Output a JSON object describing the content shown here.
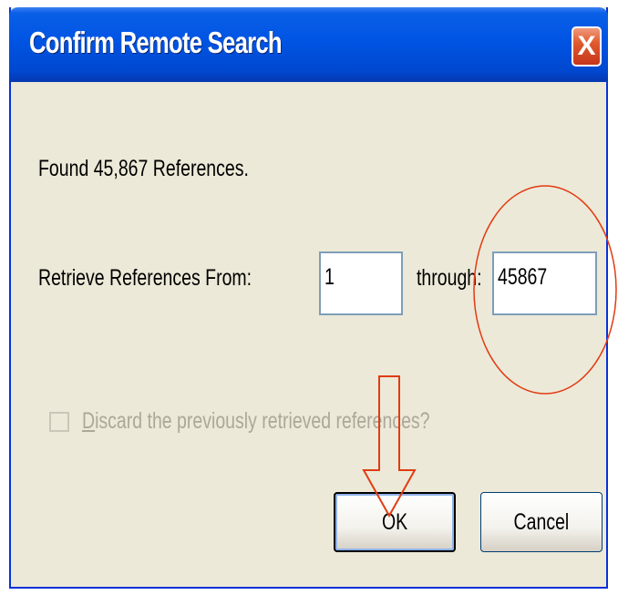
{
  "window": {
    "title": "Confirm Remote Search",
    "close_glyph": "X"
  },
  "message": {
    "found_text": "Found 45,867 References."
  },
  "range": {
    "from_label": "Retrieve References From:",
    "from_value": "1",
    "through_label": "through:",
    "through_value": "45867"
  },
  "discard": {
    "mnemonic": "D",
    "label_rest": "iscard the previously retrieved references?",
    "checked": false,
    "enabled": false
  },
  "buttons": {
    "ok_label": "OK",
    "cancel_label": "Cancel"
  },
  "annotations": {
    "circle_color": "#e23b12",
    "arrow_color": "#e23b12"
  },
  "colors": {
    "titlebar": "#0054e3",
    "dialog_bg": "#ece9d8",
    "disabled_text": "#aca899"
  }
}
